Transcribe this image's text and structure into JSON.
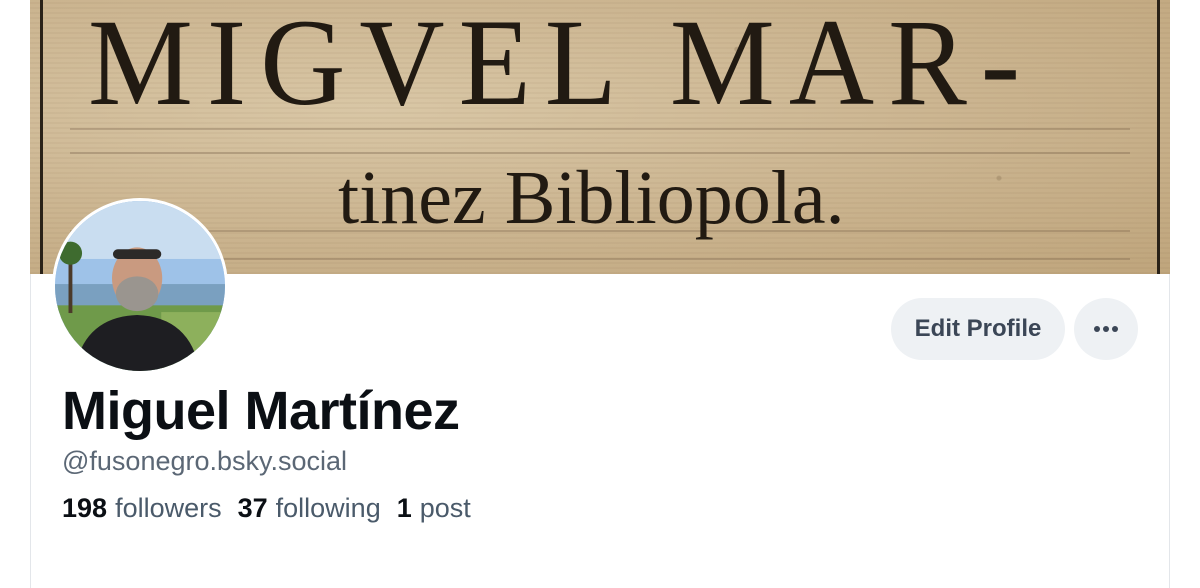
{
  "banner": {
    "line1": "MIGVEL MAR-",
    "line2": "tinez Bibliopola."
  },
  "profile": {
    "display_name": "Miguel Martínez",
    "handle": "@fusonegro.bsky.social",
    "stats": {
      "followers_count": "198",
      "followers_label": "followers",
      "following_count": "37",
      "following_label": "following",
      "posts_count": "1",
      "posts_label": "post"
    }
  },
  "actions": {
    "edit_label": "Edit Profile",
    "more_icon": "ellipsis-icon"
  },
  "colors": {
    "button_bg": "#eef1f4",
    "button_text": "#3b4656",
    "name_text": "#0b0f14",
    "secondary_text": "#5b6775"
  }
}
